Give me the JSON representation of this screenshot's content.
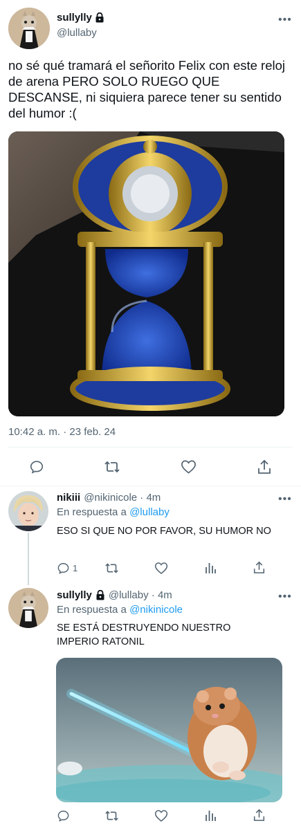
{
  "main_tweet": {
    "author_name": "sullylly",
    "author_handle": "@lullaby",
    "text": "no sé qué tramará el señorito Felix con este reloj de arena PERO SOLO RUEGO QUE DESCANSE, ni siquiera parece tener su sentido del humor :(",
    "timestamp": "10:42 a. m. · 23 feb. 24"
  },
  "reply1": {
    "author_name": "nikiii",
    "author_handle": "@nikinicole · 4m",
    "reply_prefix": "En respuesta a",
    "reply_target": "@lullaby",
    "text": "ESO SI QUE NO POR FAVOR, SU HUMOR NO",
    "reply_count": "1"
  },
  "reply2": {
    "author_name": "sullylly",
    "author_handle": "@lullaby · 4m",
    "reply_prefix": "En respuesta a",
    "reply_target": "@nikinicole",
    "text": "SE ESTÁ DESTRUYENDO NUESTRO IMPERIO RATONIL"
  },
  "icons": {
    "lock": "lock-icon",
    "reply": "reply-icon",
    "retweet": "retweet-icon",
    "like": "heart-icon",
    "share": "share-icon",
    "views": "views-icon",
    "more": "more-icon"
  },
  "colors": {
    "text": "#0f1419",
    "secondary": "#536471",
    "link": "#1d9bf0",
    "divider": "#eff3f4"
  }
}
